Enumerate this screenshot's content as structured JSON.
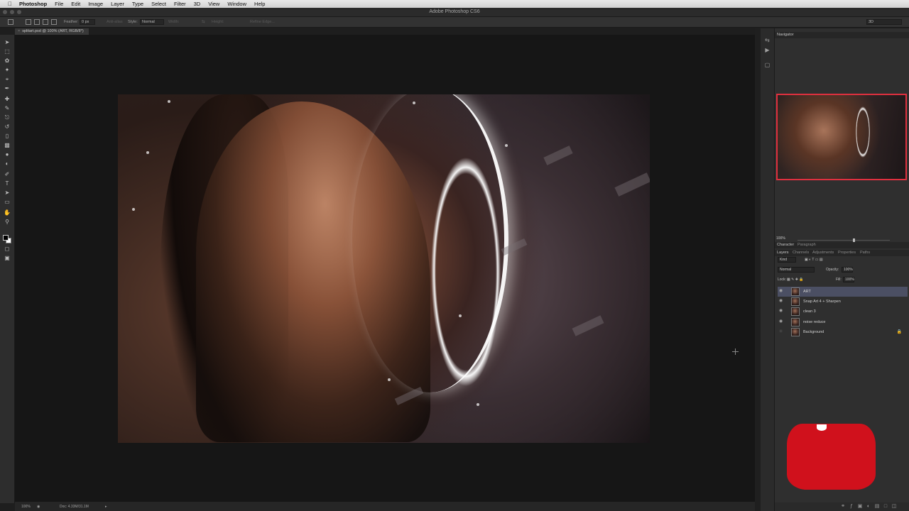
{
  "menubar": {
    "apple_icon": "apple-icon",
    "app_name": "Photoshop",
    "items": [
      "File",
      "Edit",
      "Image",
      "Layer",
      "Type",
      "Select",
      "Filter",
      "3D",
      "View",
      "Window",
      "Help"
    ]
  },
  "window": {
    "title": "Adobe Photoshop CS6"
  },
  "options": {
    "feather_label": "Feather:",
    "feather_value": "0 px",
    "antialias_label": "Anti-alias",
    "style_label": "Style:",
    "style_value": "Normal",
    "width_label": "Width:",
    "height_label": "Height:",
    "refine_label": "Refine Edge...",
    "workspace_value": "3D"
  },
  "document": {
    "tab_title": "splitart.psd @ 100% (ART, RGB/8*)"
  },
  "status": {
    "zoom": "100%",
    "doc_size": "Doc: 4.33M/31.1M"
  },
  "panels": {
    "navigator_tab": "Navigator",
    "navigator_zoom": "100%",
    "character_tab": "Character",
    "paragraph_tab": "Paragraph",
    "layer_tabs": [
      "Layers",
      "Channels",
      "Adjustments",
      "Properties",
      "Paths"
    ],
    "kind_label": "Kind",
    "blend_mode": "Normal",
    "opacity_label": "Opacity:",
    "opacity_value": "100%",
    "lock_label": "Lock:",
    "fill_label": "Fill:",
    "fill_value": "100%",
    "layers": [
      {
        "name": "ART",
        "active": true
      },
      {
        "name": "Snap Art 4 + Sharpen",
        "active": false
      },
      {
        "name": "clean 3",
        "active": false
      },
      {
        "name": "noise reduce",
        "active": false
      },
      {
        "name": "Background",
        "active": false,
        "locked": true
      }
    ]
  },
  "colors": {
    "accent_red": "#d0111c",
    "selected_layer": "#4b4f63",
    "navigator_box": "#e0303f"
  }
}
